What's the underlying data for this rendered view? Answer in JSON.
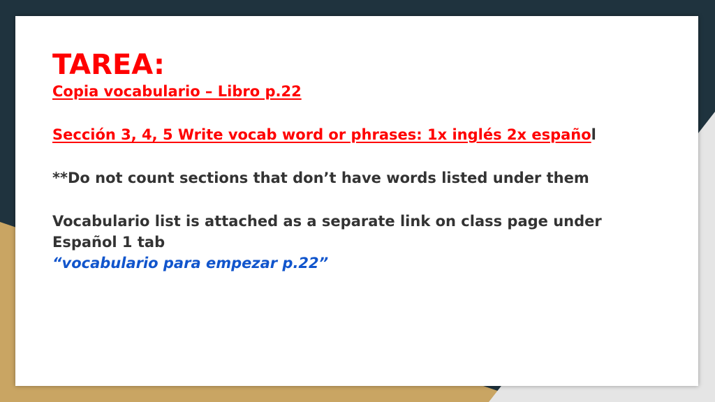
{
  "colors": {
    "background_dark": "#1f333e",
    "background_gold": "#c9a563",
    "background_gray": "#e5e5e5",
    "title_red": "#ff0000",
    "body_text": "#333333",
    "link_blue": "#1155cc"
  },
  "slide": {
    "title": "TAREA:",
    "subtitle": "Copia vocabulario – Libro p.22",
    "section_red": "Sección 3, 4, 5 Write vocab word or phrases: 1x inglés  2x españo",
    "section_tail": "l",
    "note": "**Do not count sections that don’t have words listed under them",
    "list_line1": "Vocabulario list is attached as a separate link on class page under",
    "list_line2": "Español 1 tab",
    "link_text": "“vocabulario para empezar p.22”"
  }
}
